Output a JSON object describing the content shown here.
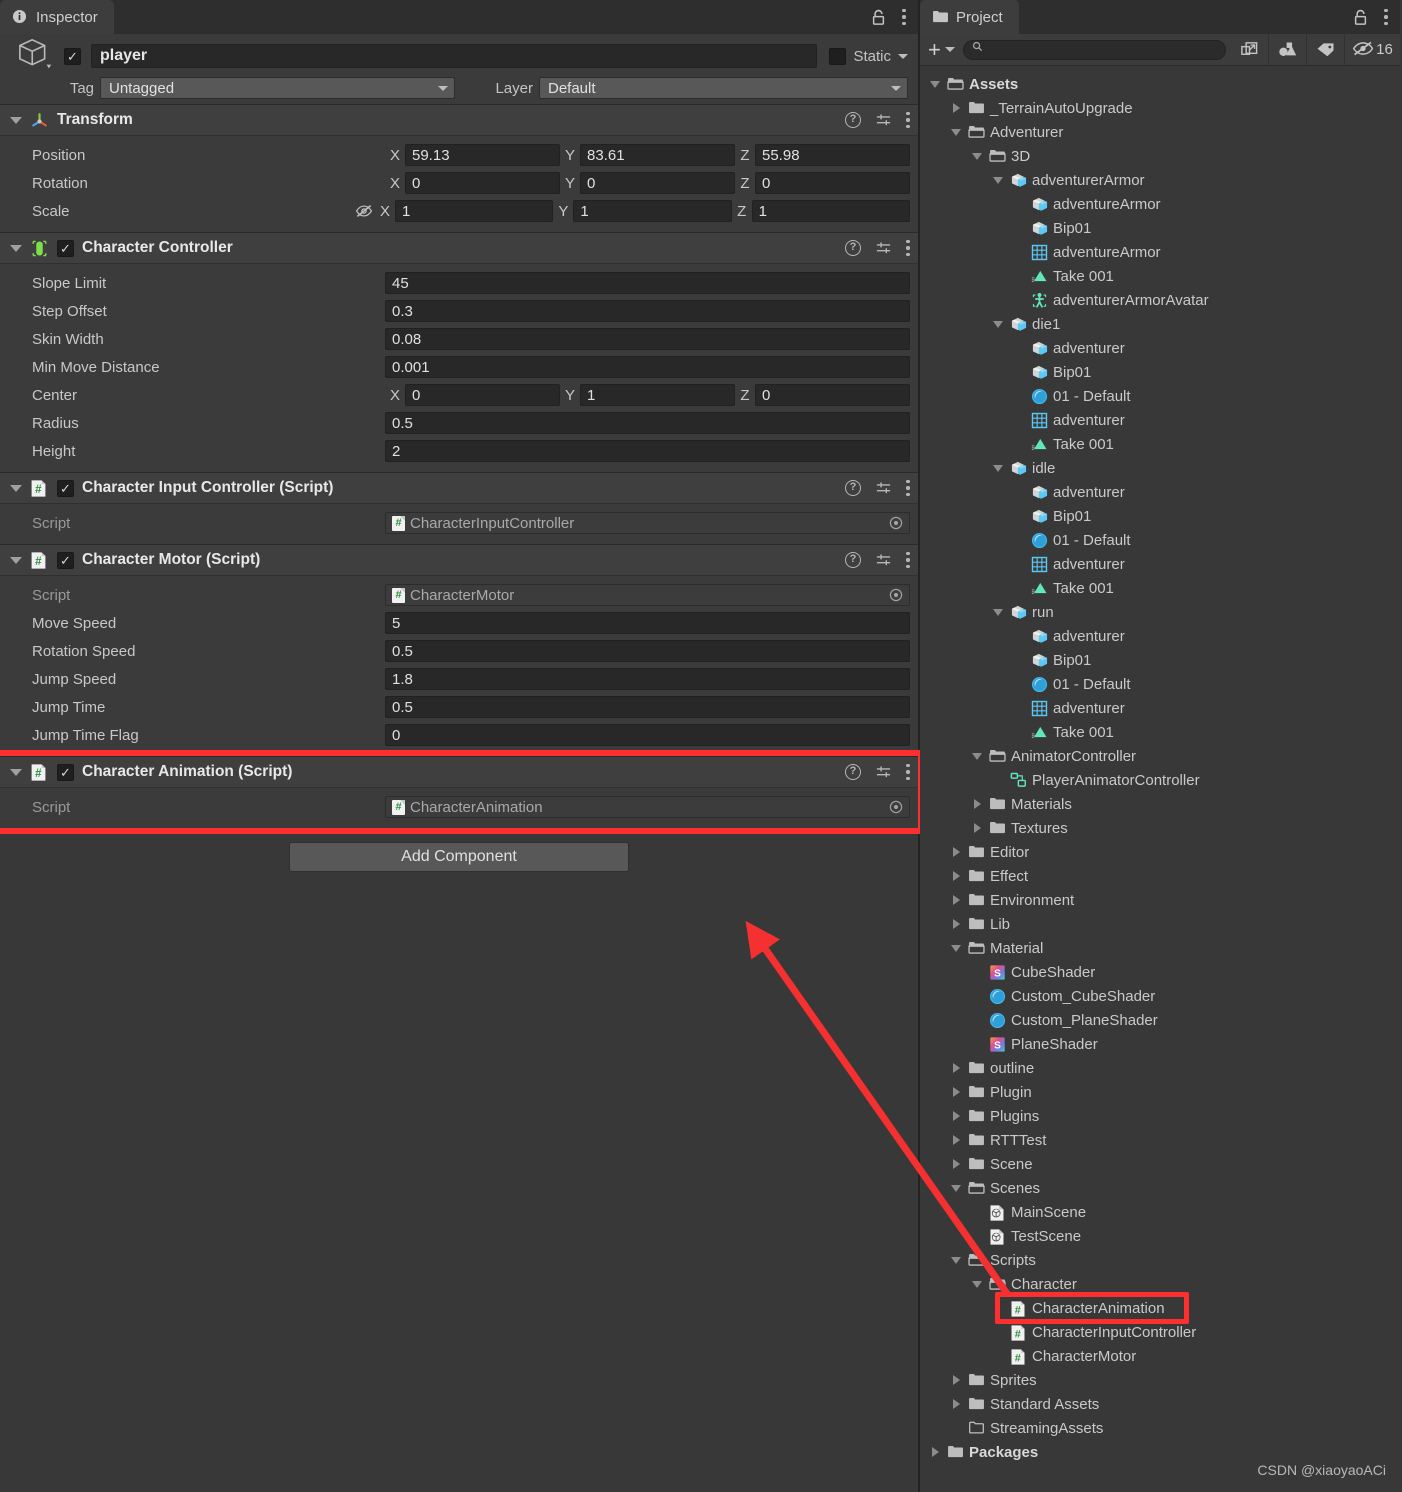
{
  "inspector": {
    "tab_label": "Inspector",
    "lock_icon": "lock-icon",
    "menu_icon": "kebab-menu-icon",
    "gameobject": {
      "enabled_checkbox": "✓",
      "name": "player",
      "static_label": "Static",
      "tag_label": "Tag",
      "tag_value": "Untagged",
      "layer_label": "Layer",
      "layer_value": "Default"
    },
    "components": [
      {
        "id": "transform",
        "title": "Transform",
        "icon": "transform-axis-icon",
        "has_checkbox": false,
        "rows": [
          {
            "type": "vec3",
            "label": "Position",
            "x": "59.13",
            "y": "83.61",
            "z": "55.98"
          },
          {
            "type": "vec3",
            "label": "Rotation",
            "x": "0",
            "y": "0",
            "z": "0"
          },
          {
            "type": "vec3",
            "label": "Scale",
            "x": "1",
            "y": "1",
            "z": "1",
            "link_icon": "scale-lock-off-icon"
          }
        ]
      },
      {
        "id": "character-controller",
        "title": "Character Controller",
        "icon": "character-controller-icon",
        "has_checkbox": true,
        "checked": true,
        "rows": [
          {
            "type": "text",
            "label": "Slope Limit",
            "value": "45"
          },
          {
            "type": "text",
            "label": "Step Offset",
            "value": "0.3"
          },
          {
            "type": "text",
            "label": "Skin Width",
            "value": "0.08"
          },
          {
            "type": "text",
            "label": "Min Move Distance",
            "value": "0.001"
          },
          {
            "type": "vec3",
            "label": "Center",
            "x": "0",
            "y": "1",
            "z": "0"
          },
          {
            "type": "text",
            "label": "Radius",
            "value": "0.5"
          },
          {
            "type": "text",
            "label": "Height",
            "value": "2"
          }
        ]
      },
      {
        "id": "character-input-controller",
        "title": "Character Input Controller (Script)",
        "icon": "cs-script-icon",
        "has_checkbox": true,
        "checked": true,
        "rows": [
          {
            "type": "object",
            "label": "Script",
            "value": "CharacterInputController"
          }
        ]
      },
      {
        "id": "character-motor",
        "title": "Character Motor (Script)",
        "icon": "cs-script-icon",
        "has_checkbox": true,
        "checked": true,
        "rows": [
          {
            "type": "object",
            "label": "Script",
            "value": "CharacterMotor"
          },
          {
            "type": "text",
            "label": "Move Speed",
            "value": "5"
          },
          {
            "type": "text",
            "label": "Rotation Speed",
            "value": "0.5"
          },
          {
            "type": "text",
            "label": "Jump Speed",
            "value": "1.8"
          },
          {
            "type": "text",
            "label": "Jump Time",
            "value": "0.5"
          },
          {
            "type": "text",
            "label": "Jump Time Flag",
            "value": "0"
          }
        ]
      },
      {
        "id": "character-animation",
        "title": "Character Animation (Script)",
        "icon": "cs-script-icon",
        "has_checkbox": true,
        "checked": true,
        "highlighted": true,
        "rows": [
          {
            "type": "object",
            "label": "Script",
            "value": "CharacterAnimation"
          }
        ]
      }
    ],
    "add_component_label": "Add Component"
  },
  "project": {
    "tab_label": "Project",
    "lock_icon": "lock-icon",
    "menu_icon": "kebab-menu-icon",
    "toolbar": {
      "create_label": "+",
      "search_placeholder": "",
      "search_value": "",
      "search_icon": "magnifier-icon",
      "open_in_window_icon": "open-in-new-window-icon",
      "type_filter_icon": "shapes-filter-icon",
      "label_filter_icon": "tag-filter-icon",
      "hidden_count_icon": "eye-off-icon",
      "hidden_count": "16"
    },
    "tree": [
      {
        "depth": 0,
        "label": "Assets",
        "icon": "folder-open-icon",
        "toggle": "down",
        "bold": true
      },
      {
        "depth": 1,
        "label": "_TerrainAutoUpgrade",
        "icon": "folder-icon",
        "toggle": "right"
      },
      {
        "depth": 1,
        "label": "Adventurer",
        "icon": "folder-open-icon",
        "toggle": "down"
      },
      {
        "depth": 2,
        "label": "3D",
        "icon": "folder-open-icon",
        "toggle": "down"
      },
      {
        "depth": 3,
        "label": "adventurerArmor",
        "icon": "model-icon",
        "toggle": "down"
      },
      {
        "depth": 4,
        "label": "adventureArmor",
        "icon": "model-icon",
        "toggle": "none"
      },
      {
        "depth": 4,
        "label": "Bip01",
        "icon": "model-icon",
        "toggle": "none"
      },
      {
        "depth": 4,
        "label": "adventureArmor",
        "icon": "mesh-icon",
        "toggle": "none"
      },
      {
        "depth": 4,
        "label": "Take 001",
        "icon": "animation-clip-icon",
        "toggle": "none"
      },
      {
        "depth": 4,
        "label": "adventurerArmorAvatar",
        "icon": "avatar-icon",
        "toggle": "none"
      },
      {
        "depth": 3,
        "label": "die1",
        "icon": "model-icon",
        "toggle": "down"
      },
      {
        "depth": 4,
        "label": "adventurer",
        "icon": "model-icon",
        "toggle": "none"
      },
      {
        "depth": 4,
        "label": "Bip01",
        "icon": "model-icon",
        "toggle": "none"
      },
      {
        "depth": 4,
        "label": "01 - Default",
        "icon": "material-icon",
        "toggle": "none"
      },
      {
        "depth": 4,
        "label": "adventurer",
        "icon": "mesh-icon",
        "toggle": "none"
      },
      {
        "depth": 4,
        "label": "Take 001",
        "icon": "animation-clip-icon",
        "toggle": "none"
      },
      {
        "depth": 3,
        "label": "idle",
        "icon": "model-icon",
        "toggle": "down"
      },
      {
        "depth": 4,
        "label": "adventurer",
        "icon": "model-icon",
        "toggle": "none"
      },
      {
        "depth": 4,
        "label": "Bip01",
        "icon": "model-icon",
        "toggle": "none"
      },
      {
        "depth": 4,
        "label": "01 - Default",
        "icon": "material-icon",
        "toggle": "none"
      },
      {
        "depth": 4,
        "label": "adventurer",
        "icon": "mesh-icon",
        "toggle": "none"
      },
      {
        "depth": 4,
        "label": "Take 001",
        "icon": "animation-clip-icon",
        "toggle": "none"
      },
      {
        "depth": 3,
        "label": "run",
        "icon": "model-icon",
        "toggle": "down"
      },
      {
        "depth": 4,
        "label": "adventurer",
        "icon": "model-icon",
        "toggle": "none"
      },
      {
        "depth": 4,
        "label": "Bip01",
        "icon": "model-icon",
        "toggle": "none"
      },
      {
        "depth": 4,
        "label": "01 - Default",
        "icon": "material-icon",
        "toggle": "none"
      },
      {
        "depth": 4,
        "label": "adventurer",
        "icon": "mesh-icon",
        "toggle": "none"
      },
      {
        "depth": 4,
        "label": "Take 001",
        "icon": "animation-clip-icon",
        "toggle": "none"
      },
      {
        "depth": 2,
        "label": "AnimatorController",
        "icon": "folder-open-icon",
        "toggle": "down"
      },
      {
        "depth": 3,
        "label": "PlayerAnimatorController",
        "icon": "animator-controller-icon",
        "toggle": "none"
      },
      {
        "depth": 2,
        "label": "Materials",
        "icon": "folder-icon",
        "toggle": "right"
      },
      {
        "depth": 2,
        "label": "Textures",
        "icon": "folder-icon",
        "toggle": "right"
      },
      {
        "depth": 1,
        "label": "Editor",
        "icon": "folder-icon",
        "toggle": "right"
      },
      {
        "depth": 1,
        "label": "Effect",
        "icon": "folder-icon",
        "toggle": "right"
      },
      {
        "depth": 1,
        "label": "Environment",
        "icon": "folder-icon",
        "toggle": "right"
      },
      {
        "depth": 1,
        "label": "Lib",
        "icon": "folder-icon",
        "toggle": "right"
      },
      {
        "depth": 1,
        "label": "Material",
        "icon": "folder-open-icon",
        "toggle": "down"
      },
      {
        "depth": 2,
        "label": "CubeShader",
        "icon": "shader-icon",
        "toggle": "none"
      },
      {
        "depth": 2,
        "label": "Custom_CubeShader",
        "icon": "material-icon",
        "toggle": "none"
      },
      {
        "depth": 2,
        "label": "Custom_PlaneShader",
        "icon": "material-icon",
        "toggle": "none"
      },
      {
        "depth": 2,
        "label": "PlaneShader",
        "icon": "shader-icon",
        "toggle": "none"
      },
      {
        "depth": 1,
        "label": "outline",
        "icon": "folder-icon",
        "toggle": "right"
      },
      {
        "depth": 1,
        "label": "Plugin",
        "icon": "folder-icon",
        "toggle": "right"
      },
      {
        "depth": 1,
        "label": "Plugins",
        "icon": "folder-icon",
        "toggle": "right"
      },
      {
        "depth": 1,
        "label": "RTTTest",
        "icon": "folder-icon",
        "toggle": "right"
      },
      {
        "depth": 1,
        "label": "Scene",
        "icon": "folder-icon",
        "toggle": "right"
      },
      {
        "depth": 1,
        "label": "Scenes",
        "icon": "folder-open-icon",
        "toggle": "down"
      },
      {
        "depth": 2,
        "label": "MainScene",
        "icon": "scene-icon",
        "toggle": "none"
      },
      {
        "depth": 2,
        "label": "TestScene",
        "icon": "scene-icon",
        "toggle": "none"
      },
      {
        "depth": 1,
        "label": "Scripts",
        "icon": "folder-open-icon",
        "toggle": "down"
      },
      {
        "depth": 2,
        "label": "Character",
        "icon": "folder-open-icon",
        "toggle": "down"
      },
      {
        "depth": 3,
        "label": "CharacterAnimation",
        "icon": "cs-script-icon",
        "toggle": "none",
        "highlighted": true
      },
      {
        "depth": 3,
        "label": "CharacterInputController",
        "icon": "cs-script-icon",
        "toggle": "none"
      },
      {
        "depth": 3,
        "label": "CharacterMotor",
        "icon": "cs-script-icon",
        "toggle": "none"
      },
      {
        "depth": 1,
        "label": "Sprites",
        "icon": "folder-icon",
        "toggle": "right"
      },
      {
        "depth": 1,
        "label": "Standard Assets",
        "icon": "folder-icon",
        "toggle": "right"
      },
      {
        "depth": 1,
        "label": "StreamingAssets",
        "icon": "folder-empty-icon",
        "toggle": "none"
      },
      {
        "depth": 0,
        "label": "Packages",
        "icon": "folder-icon",
        "toggle": "right",
        "bold": true
      }
    ]
  },
  "annotations": {
    "highlight_color": "#ff2f2f",
    "arrow_color": "#f53030",
    "watermark": "CSDN @xiaoyaoACi"
  }
}
